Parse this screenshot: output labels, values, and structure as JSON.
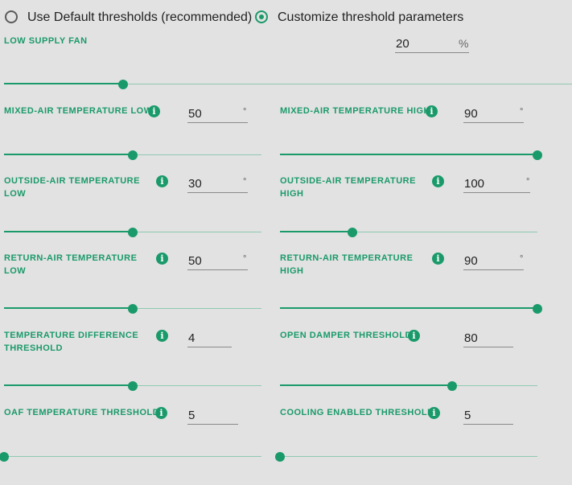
{
  "mode": {
    "default_label": "Use Default thresholds (recommended)",
    "custom_label": "Customize threshold parameters",
    "selected": "custom"
  },
  "info_glyph": "i",
  "low_supply_fan": {
    "label": "LOW SUPPLY FAN",
    "value": "20",
    "unit": "%",
    "level": 0.21
  },
  "fields": [
    {
      "id": "mat-low",
      "label_lines": [
        "MIXED-AIR TEMPERATURE LOW"
      ],
      "value": "50",
      "unit": "°",
      "level": 0.5
    },
    {
      "id": "mat-high",
      "label_lines": [
        "MIXED-AIR TEMPERATURE HIGH"
      ],
      "value": "90",
      "unit": "°",
      "level": 1.0
    },
    {
      "id": "oat-low",
      "label_lines": [
        "OUTSIDE-AIR TEMPERATURE",
        "LOW"
      ],
      "value": "30",
      "unit": "°",
      "level": 0.5
    },
    {
      "id": "oat-high",
      "label_lines": [
        "OUTSIDE-AIR TEMPERATURE",
        "HIGH"
      ],
      "value": "100",
      "unit": "°",
      "level": 0.28
    },
    {
      "id": "rat-low",
      "label_lines": [
        "RETURN-AIR TEMPERATURE",
        "LOW"
      ],
      "value": "50",
      "unit": "°",
      "level": 0.5
    },
    {
      "id": "rat-high",
      "label_lines": [
        "RETURN-AIR TEMPERATURE",
        "HIGH"
      ],
      "value": "90",
      "unit": "°",
      "level": 1.0
    },
    {
      "id": "temp-diff",
      "label_lines": [
        "TEMPERATURE DIFFERENCE",
        "THRESHOLD"
      ],
      "value": "4",
      "unit": "",
      "level": 0.5
    },
    {
      "id": "open-damper",
      "label_lines": [
        "OPEN DAMPER THRESHOLD"
      ],
      "value": "80",
      "unit": "",
      "level": 0.67
    },
    {
      "id": "oaf-temp",
      "label_lines": [
        "OAF TEMPERATURE THRESHOLD"
      ],
      "value": "5",
      "unit": "",
      "level": 0.0
    },
    {
      "id": "cooling-enabled",
      "label_lines": [
        "COOLING ENABLED THRESHOLD"
      ],
      "value": "5",
      "unit": "",
      "level": 0.0
    }
  ],
  "colors": {
    "accent": "#1a9a6a",
    "track": "#8fc9b1",
    "background": "#e2e2e2"
  }
}
